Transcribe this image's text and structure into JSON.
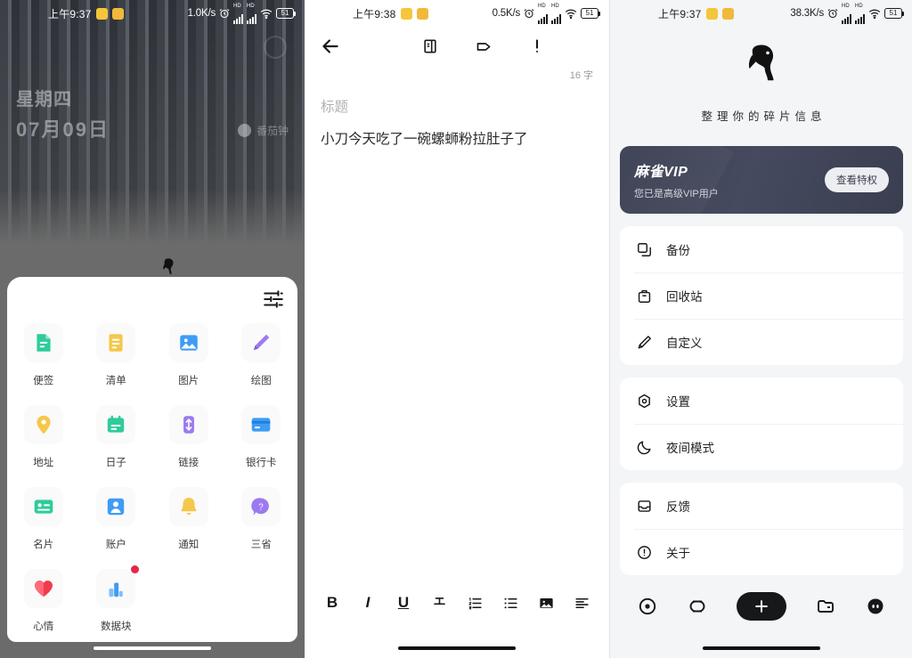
{
  "panels": {
    "launcher": {
      "status": {
        "time": "上午9:37",
        "net_speed": "1.0K/s",
        "battery": "51"
      },
      "wallpaper": {
        "weekday": "星期四",
        "date": "07月09日",
        "pomodoro": "番茄钟"
      },
      "widgets": [
        {
          "label": "便签",
          "icon": "note-icon",
          "color": "#2ecc9b"
        },
        {
          "label": "清单",
          "icon": "checklist-icon",
          "color": "#f5c84b"
        },
        {
          "label": "图片",
          "icon": "image-icon",
          "color": "#3f9cf5"
        },
        {
          "label": "绘图",
          "icon": "pencil-icon",
          "color": "#9b7af0"
        },
        {
          "label": "地址",
          "icon": "location-pin-icon",
          "color": "#f6c killer"
        },
        {
          "label": "日子",
          "icon": "calendar-icon",
          "color": "#2ecc9b"
        },
        {
          "label": "链接",
          "icon": "link-icon",
          "color": "#9b7af0"
        },
        {
          "label": "银行卡",
          "icon": "credit-card-icon",
          "color": "#3f9cf5"
        },
        {
          "label": "名片",
          "icon": "contact-card-icon",
          "color": "#2ecc9b"
        },
        {
          "label": "账户",
          "icon": "account-icon",
          "color": "#3f9cf5"
        },
        {
          "label": "通知",
          "icon": "bell-icon",
          "color": "#f5c84b"
        },
        {
          "label": "三省",
          "icon": "question-bubble-icon",
          "color": "#9b7af0"
        },
        {
          "label": "心情",
          "icon": "heart-icon",
          "color": "#ef3b4e"
        },
        {
          "label": "数据块",
          "icon": "bar-chart-icon",
          "color": "#3f9cf5"
        }
      ]
    },
    "editor": {
      "status": {
        "time": "上午9:38",
        "net_speed": "0.5K/s",
        "battery": "51"
      },
      "word_count": "16 字",
      "title_placeholder": "标题",
      "content": "小刀今天吃了一碗螺蛳粉拉肚子了",
      "actions": [
        {
          "name": "book-icon"
        },
        {
          "name": "tag-icon"
        },
        {
          "name": "exclamation-icon"
        }
      ],
      "format_tools": [
        {
          "name": "bold-icon",
          "glyph": "B"
        },
        {
          "name": "italic-icon",
          "glyph": "I"
        },
        {
          "name": "underline-icon",
          "glyph": "U"
        },
        {
          "name": "strikethrough-icon",
          "glyph": "T"
        },
        {
          "name": "ordered-list-icon",
          "glyph": ""
        },
        {
          "name": "bullet-list-icon",
          "glyph": ""
        },
        {
          "name": "insert-image-icon",
          "glyph": ""
        },
        {
          "name": "align-icon",
          "glyph": ""
        }
      ]
    },
    "profile": {
      "status": {
        "time": "上午9:37",
        "net_speed": "38.3K/s",
        "battery": "51"
      },
      "logo": "sparrow-bird-logo",
      "tagline": "整理你的碎片信息",
      "vip": {
        "title": "麻雀VIP",
        "subtitle": "您已是高级VIP用户",
        "button": "查看特权"
      },
      "groups": [
        {
          "items": [
            {
              "label": "备份",
              "icon": "copy-icon"
            },
            {
              "label": "回收站",
              "icon": "trash-icon"
            },
            {
              "label": "自定义",
              "icon": "pencil-icon"
            }
          ]
        },
        {
          "items": [
            {
              "label": "设置",
              "icon": "gear-icon"
            },
            {
              "label": "夜间模式",
              "icon": "moon-icon"
            }
          ]
        },
        {
          "items": [
            {
              "label": "反馈",
              "icon": "inbox-icon"
            },
            {
              "label": "关于",
              "icon": "info-icon"
            }
          ]
        }
      ],
      "tabs": [
        {
          "name": "tab-target-icon"
        },
        {
          "name": "tab-capsule-icon"
        },
        {
          "name": "tab-add-button"
        },
        {
          "name": "tab-folder-icon"
        },
        {
          "name": "tab-face-icon"
        }
      ]
    }
  }
}
